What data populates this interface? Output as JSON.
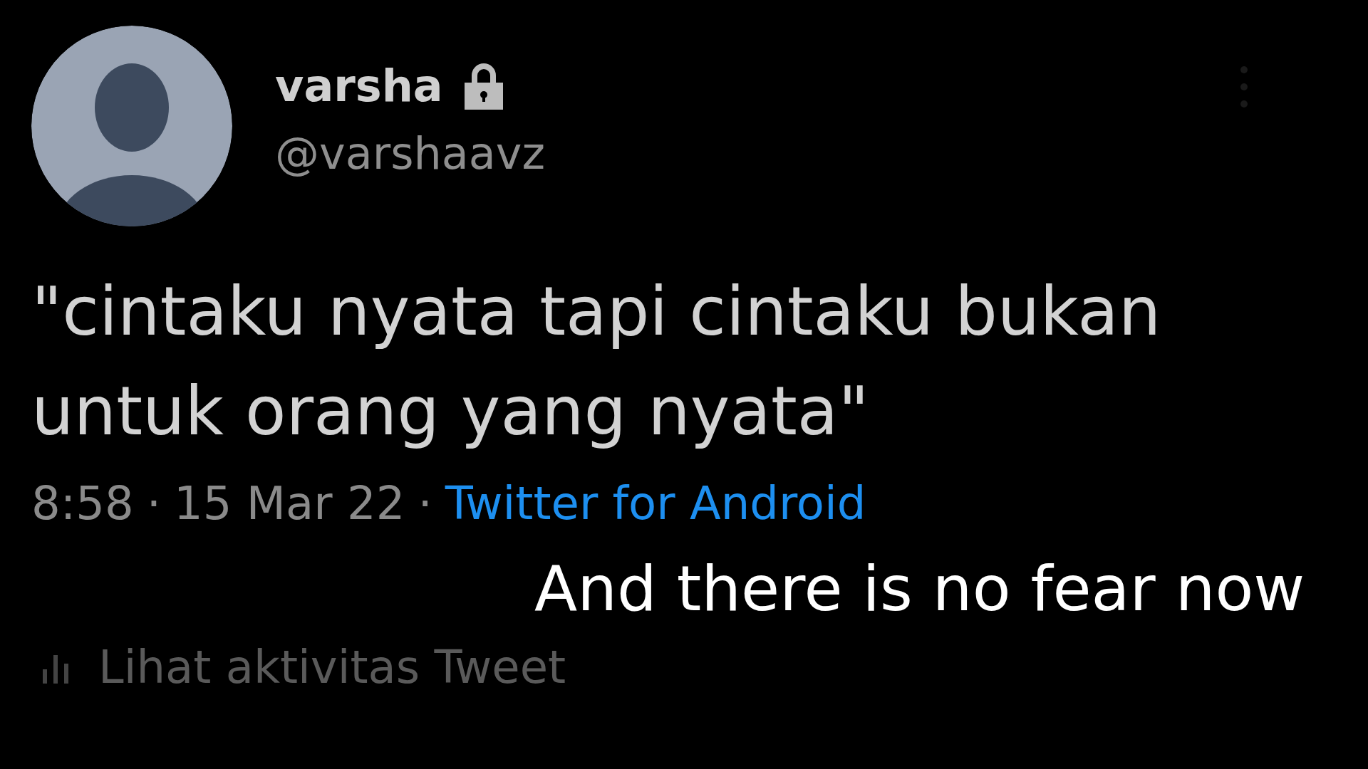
{
  "tweet": {
    "display_name": "varsha",
    "protected": true,
    "handle": "@varshaavz",
    "text": "\"cintaku nyata tapi cintaku bukan untuk orang yang nyata\"",
    "time": "8:58",
    "date": "15 Mar 22",
    "source": "Twitter for Android",
    "separators": [
      "·",
      "·"
    ],
    "activity_link": "Lihat aktivitas Tweet"
  },
  "caption": "And there is no fear now"
}
